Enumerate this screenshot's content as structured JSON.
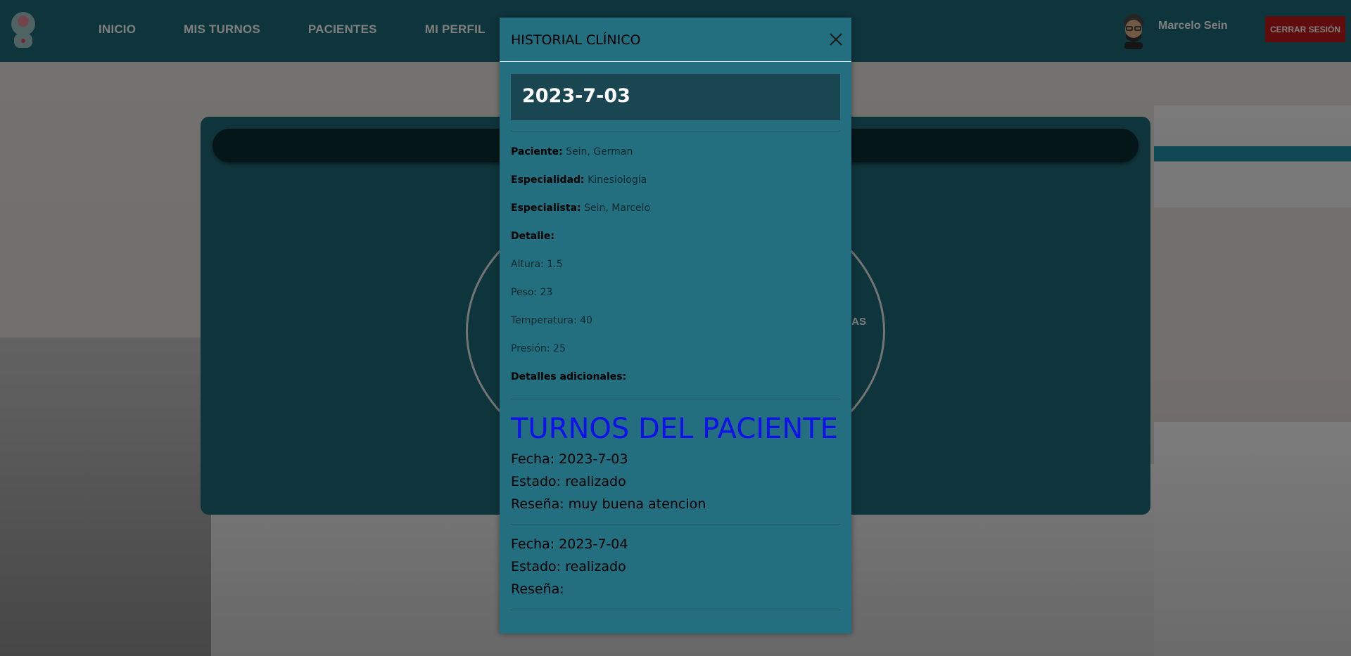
{
  "nav": {
    "links": [
      "INICIO",
      "MIS TURNOS",
      "PACIENTES",
      "MI PERFIL"
    ],
    "user_name": "Marcelo Sein",
    "logout_label": "CERRAR SESIÓN"
  },
  "panel": {
    "circle_label_fragment": "AS"
  },
  "modal": {
    "title": "HISTORIAL CLÍNICO",
    "date": "2023-7-03",
    "paciente_label": "Paciente:",
    "paciente_value": "Sein, German",
    "especialidad_label": "Especialidad:",
    "especialidad_value": "Kinesiología",
    "especialista_label": "Especialista:",
    "especialista_value": "Sein, Marcelo",
    "detalle_label": "Detalle:",
    "detalles": [
      "Altura: 1.5",
      "Peso: 23",
      "Temperatura: 40",
      "Presión: 25"
    ],
    "detalles_adicionales_label": "Detalles adicionales:",
    "turnos_title": "TURNOS DEL PACIENTE",
    "turnos": [
      {
        "fecha": "Fecha: 2023-7-03",
        "estado": "Estado: realizado",
        "resena": "Reseña: muy buena atencion"
      },
      {
        "fecha": "Fecha: 2023-7-04",
        "estado": "Estado: realizado",
        "resena": "Reseña:"
      }
    ]
  },
  "colors": {
    "navbar": "#1f6b78",
    "modal": "#236e7f",
    "logout": "#c01818",
    "section_title": "#1010ee"
  }
}
